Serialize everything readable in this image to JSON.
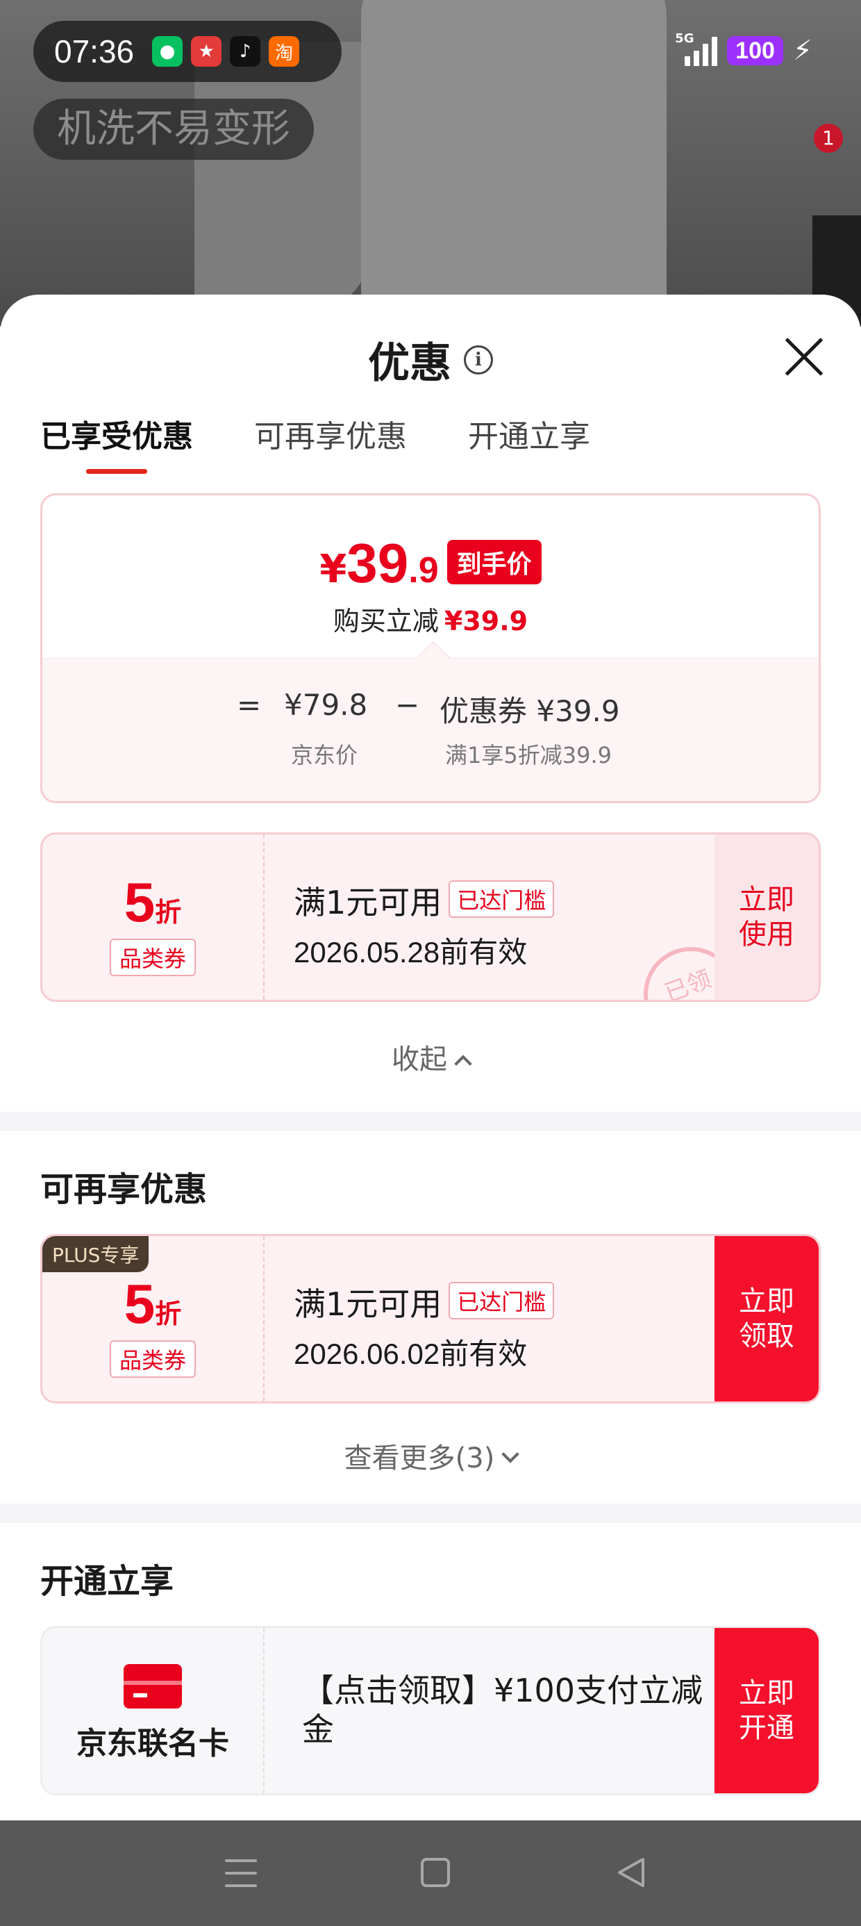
{
  "status_bar": {
    "time": "07:36",
    "network": "5G",
    "battery": "100",
    "app_icons": [
      "wechat-icon",
      "game-app-icon",
      "tiktok-icon",
      "taobao-icon"
    ]
  },
  "background": {
    "tag_text": "机洗不易变形",
    "badge_count": "1"
  },
  "sheet": {
    "title": "优惠",
    "tabs": [
      {
        "label": "已享受优惠",
        "active": true
      },
      {
        "label": "可再享优惠",
        "active": false
      },
      {
        "label": "开通立享",
        "active": false
      }
    ],
    "summary": {
      "currency": "¥",
      "final_int": "39",
      "final_dec": ".9",
      "final_tag": "到手价",
      "buy_label": "购买立减",
      "buy_value": "¥39.9",
      "eq": "=",
      "jd_price": "¥79.8",
      "minus": "−",
      "coupon_label": "优惠券 ¥39.9",
      "jd_price_label": "京东价",
      "coupon_desc": "满1享5折减39.9"
    },
    "enjoyed_coupon": {
      "discount": "5",
      "discount_unit": "折",
      "kind": "品类券",
      "condition": "满1元可用",
      "chip": "已达门槛",
      "valid": "2026.05.28前有效",
      "button": "立即\n使用",
      "stamp": "已领"
    },
    "collapse_label": "收起",
    "more_section": {
      "title": "可再享优惠",
      "coupon": {
        "plus_tag": "PLUS专享",
        "discount": "5",
        "discount_unit": "折",
        "kind": "品类券",
        "condition": "满1元可用",
        "chip": "已达门槛",
        "valid": "2026.06.02前有效",
        "button": "立即\n领取"
      },
      "more_label": "查看更多(3)"
    },
    "open_section": {
      "title": "开通立享",
      "card_name": "京东联名卡",
      "description": "【点击领取】¥100支付立减金",
      "button": "立即\n开通"
    }
  },
  "colors": {
    "accent": "#e8001c",
    "tab_underline": "#e1251b",
    "battery": "#9b30ff"
  }
}
